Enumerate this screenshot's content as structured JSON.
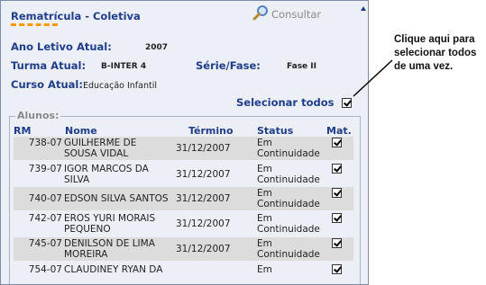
{
  "header": {
    "title": "Rematrícula - Coletiva",
    "consultar_label": "Consultar"
  },
  "info": {
    "ano_letivo_label": "Ano Letivo Atual:",
    "ano_letivo_value": "2007",
    "turma_label": "Turma Atual:",
    "turma_value": "B-INTER 4",
    "serie_label": "Série/Fase:",
    "serie_value": "Fase II",
    "curso_label": "Curso Atual:",
    "curso_value": "Educação Infantil"
  },
  "select_all": {
    "label": "Selecionar todos",
    "checked": true
  },
  "alunos": {
    "legend": "Alunos:",
    "columns": [
      "RM",
      "Nome",
      "Término",
      "Status",
      "Mat."
    ],
    "rows": [
      {
        "rm": "738-07",
        "nome": "GUILHERME DE SOUSA VIDAL",
        "termino": "31/12/2007",
        "status": "Em Continuidade",
        "mat": true
      },
      {
        "rm": "739-07",
        "nome": "IGOR MARCOS DA SILVA",
        "termino": "31/12/2007",
        "status": "Em Continuidade",
        "mat": true
      },
      {
        "rm": "740-07",
        "nome": "EDSON SILVA SANTOS",
        "termino": "31/12/2007",
        "status": "Em Continuidade",
        "mat": true
      },
      {
        "rm": "742-07",
        "nome": "EROS YURI MORAIS PEQUENO",
        "termino": "31/12/2007",
        "status": "Em Continuidade",
        "mat": true
      },
      {
        "rm": "745-07",
        "nome": "DENILSON DE LIMA MOREIRA",
        "termino": "31/12/2007",
        "status": "Em Continuidade",
        "mat": true
      },
      {
        "rm": "754-07",
        "nome": "CLAUDINEY RYAN DA",
        "termino": "",
        "status": "Em",
        "mat": true
      }
    ]
  },
  "annotation": {
    "text": "Clique aqui para selecionar todos de uma vez."
  },
  "colors": {
    "panel_bg": "#ecf0f6",
    "label_blue": "#1f3d8a",
    "accent_orange": "#ff9900",
    "row_shade": "#dcdcdc"
  },
  "icons": {
    "consultar": "magnifier-icon"
  }
}
